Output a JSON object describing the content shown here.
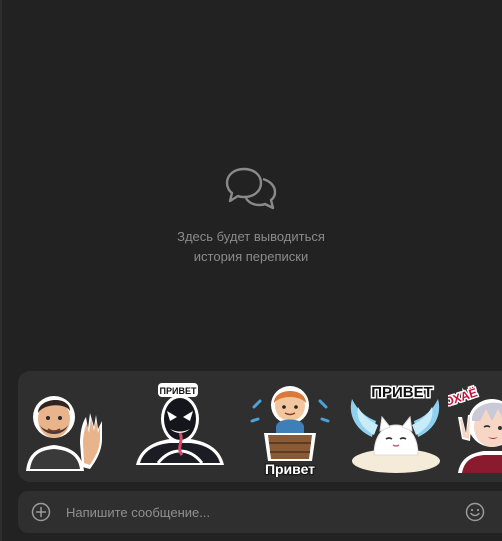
{
  "empty_state": {
    "icon": "chat-bubbles-icon",
    "line1": "Здесь будет выводиться",
    "line2": "история переписки"
  },
  "sticker_bar": {
    "stickers": [
      {
        "icon": "waving-man-sticker",
        "caption": ""
      },
      {
        "icon": "venom-sticker",
        "caption": "ПРИВЕТ"
      },
      {
        "icon": "barrel-boy-sticker",
        "caption": "Привет"
      },
      {
        "icon": "winged-cat-sticker",
        "caption": "ПРИВЕТ"
      },
      {
        "icon": "anime-boy-sticker",
        "caption": "ОХАЁ"
      }
    ]
  },
  "composer": {
    "attach_icon": "plus-circle-icon",
    "placeholder": "Напишите сообщение...",
    "value": "",
    "emoji_icon": "smile-icon"
  },
  "colors": {
    "background": "#222222",
    "panel": "#2f2f2f",
    "muted_text": "#8b8b8b"
  }
}
